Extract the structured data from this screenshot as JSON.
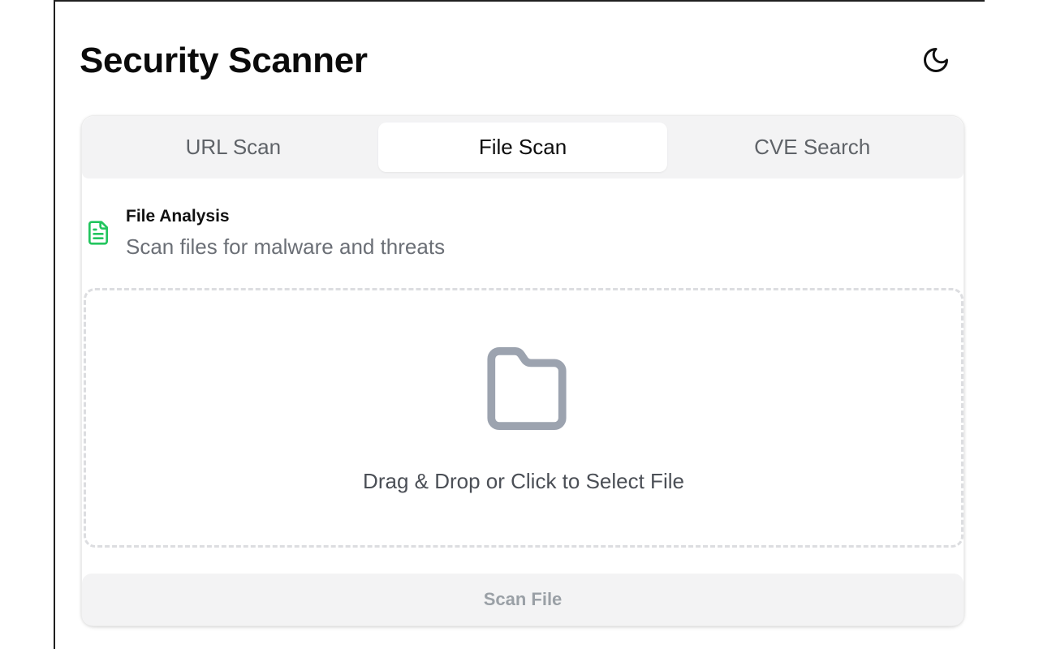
{
  "app": {
    "title": "Security Scanner"
  },
  "header": {
    "theme_toggle_icon": "moon-icon"
  },
  "tabs": [
    {
      "label": "URL Scan",
      "active": false
    },
    {
      "label": "File Scan",
      "active": true
    },
    {
      "label": "CVE Search",
      "active": false
    }
  ],
  "file_analysis": {
    "icon": "file-text-icon",
    "icon_color": "#22c55e",
    "title": "File Analysis",
    "subtitle": "Scan files for malware and threats"
  },
  "dropzone": {
    "icon": "folder-icon",
    "icon_color": "#9ca3af",
    "label": "Drag & Drop or Click to Select File"
  },
  "actions": {
    "scan_button_label": "Scan File",
    "scan_button_disabled": true
  }
}
